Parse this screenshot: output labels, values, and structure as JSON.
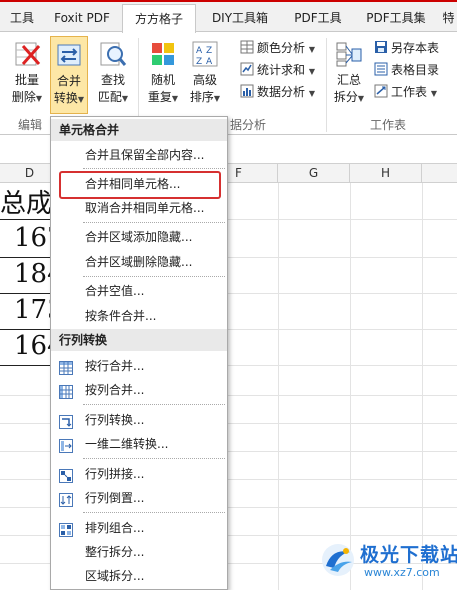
{
  "tabs": [
    "工具",
    "Foxit PDF",
    "方方格子",
    "DIY工具箱",
    "PDF工具",
    "PDF工具集",
    "特"
  ],
  "active_tab": "方方格子",
  "ribbon": {
    "batch_delete": {
      "line1": "批量",
      "line2": "删除"
    },
    "merge_convert": {
      "line1": "合并",
      "line2": "转换"
    },
    "find_match": {
      "line1": "查找",
      "line2": "匹配"
    },
    "random_repeat": {
      "line1": "随机",
      "line2": "重复"
    },
    "advanced_sort": {
      "line1": "高级",
      "line2": "排序"
    },
    "color_analysis": "颜色分析",
    "stat_sum": "统计求和",
    "data_analysis": "数据分析",
    "summary_split": {
      "line1": "汇总",
      "line2": "拆分"
    },
    "save_as_table": "另存本表",
    "table_directory": "表格目录",
    "worksheet": "工作表",
    "group_edit": "编辑",
    "group_analysis": "据分析",
    "group_worksheet": "工作表"
  },
  "columns": [
    "D",
    "E",
    "F",
    "G",
    "H"
  ],
  "cells": {
    "title": "总成",
    "r1": "167",
    "r2": "184",
    "r3": "173",
    "r4": "164"
  },
  "menu": {
    "section1": "单元格合并",
    "items1": [
      "合并且保留全部内容...",
      "合并相同单元格...",
      "取消合并相同单元格...",
      "合并区域添加隐藏...",
      "合并区域删除隐藏...",
      "合并空值...",
      "按条件合并..."
    ],
    "section2": "行列转换",
    "items2": [
      "按行合并...",
      "按列合并...",
      "行列转换...",
      "一维二维转换...",
      "行列拼接...",
      "行列倒置...",
      "排列组合...",
      "整行拆分...",
      "区域拆分..."
    ]
  },
  "watermark": {
    "title": "极光下载站",
    "url": "www.xz7.com"
  },
  "colors": {
    "highlight": "#d63030",
    "active_button": "#fde7a6",
    "watermark": "#1f6fd0"
  }
}
